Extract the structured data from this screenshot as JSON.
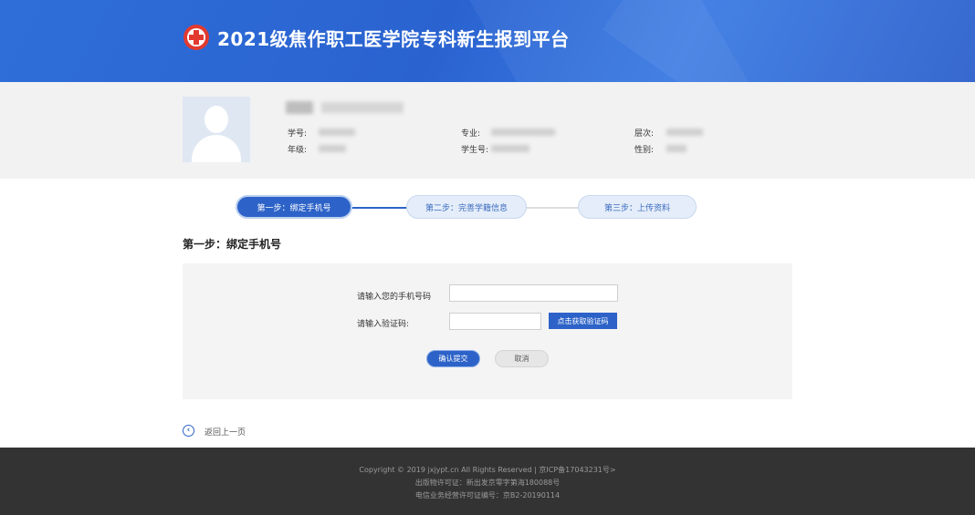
{
  "header": {
    "title": "2021级焦作职工医学院专科新生报到平台",
    "logo_icon": "medical-cross-icon"
  },
  "profile": {
    "avatar_icon": "user-avatar-icon",
    "labels": {
      "student_no": "学号:",
      "grade": "年级:",
      "major": "专业:",
      "exam_no": "学生号:",
      "level": "层次:",
      "gender": "性别:"
    }
  },
  "steps": [
    {
      "label": "第一步：绑定手机号",
      "state": "active"
    },
    {
      "label": "第二步：完善学籍信息",
      "state": "inactive"
    },
    {
      "label": "第三步：上传资料",
      "state": "inactive"
    }
  ],
  "section": {
    "title": "第一步：绑定手机号"
  },
  "form": {
    "phone_label": "请输入您的手机号码",
    "phone_value": "",
    "code_label": "请输入验证码:",
    "code_value": "",
    "get_code_button": "点击获取验证码",
    "submit_button": "确认提交",
    "cancel_button": "取消"
  },
  "back": {
    "icon": "back-arrow-icon",
    "label": "返回上一页"
  },
  "footer": {
    "line1": "Copyright © 2019 jxjypt.cn All Rights Reserved | 京ICP备17043231号>",
    "line2": "出版物许可证：新出发京零字第海180088号",
    "line3": "电信业务经营许可证编号：京B2-20190114"
  },
  "colors": {
    "brand_blue": "#2d63c8",
    "header_blue": "#2f6ed9",
    "footer_bg": "#333333",
    "panel_bg": "#f4f4f4"
  }
}
